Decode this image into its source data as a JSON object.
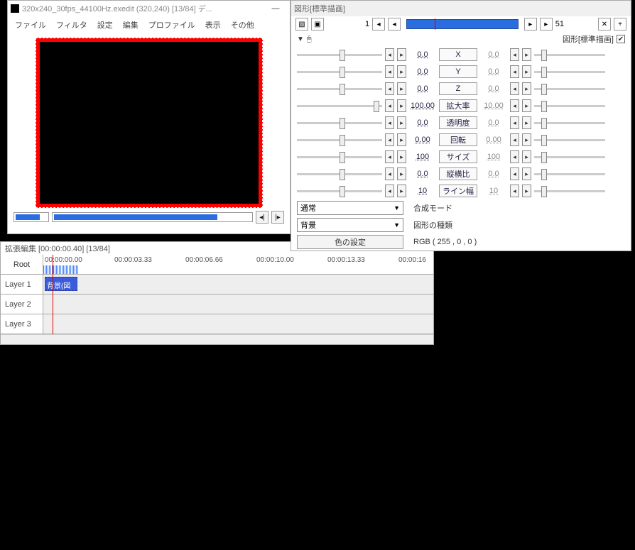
{
  "main": {
    "title": "320x240_30fps_44100Hz.exedit (320,240) [13/84] デ...",
    "minimize": "—",
    "menu": [
      "ファイル",
      "フィルタ",
      "設定",
      "編集",
      "プロファイル",
      "表示",
      "その他"
    ],
    "play_prev": "◂|",
    "play_next": "|▸"
  },
  "timeline": {
    "title": "拡張編集 [00:00:00.40] [13/84]",
    "root": "Root",
    "layers": [
      "Layer 1",
      "Layer 2",
      "Layer 3"
    ],
    "times": [
      "00:00:00.00",
      "00:00:03.33",
      "00:00:06.66",
      "00:00:10.00",
      "00:00:13.33",
      "00:00:16"
    ],
    "clip": "背景(図形"
  },
  "prop": {
    "title": "図形[標準描画]",
    "frame_start": "1",
    "frame_end": "51",
    "header_label": "図形[標準描画]",
    "plus": "+",
    "x": "✕",
    "mouse": "🖱",
    "rows": [
      {
        "name": "X",
        "v": "0.0",
        "rv": "0.0"
      },
      {
        "name": "Y",
        "v": "0.0",
        "rv": "0.0"
      },
      {
        "name": "Z",
        "v": "0.0",
        "rv": "0.0"
      },
      {
        "name": "拡大率",
        "v": "100.00",
        "rv": "10.00"
      },
      {
        "name": "透明度",
        "v": "0.0",
        "rv": "0.0"
      },
      {
        "name": "回転",
        "v": "0.00",
        "rv": "0.00"
      },
      {
        "name": "サイズ",
        "v": "100",
        "rv": "100"
      },
      {
        "name": "縦横比",
        "v": "0.0",
        "rv": "0.0"
      },
      {
        "name": "ライン幅",
        "v": "10",
        "rv": "10"
      }
    ],
    "blend_value": "通常",
    "blend_label": "合成モード",
    "shape_value": "背景",
    "shape_label": "図形の種類",
    "color_btn": "色の設定",
    "rgb": "RGB ( 255 , 0 , 0 )",
    "left": "◂",
    "right": "▸",
    "check": "✔"
  }
}
